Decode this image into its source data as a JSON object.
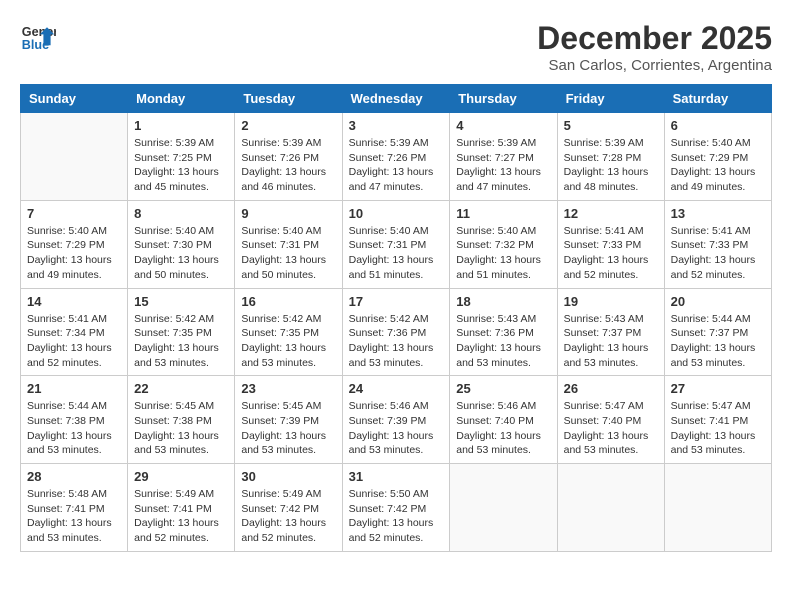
{
  "header": {
    "logo_line1": "General",
    "logo_line2": "Blue",
    "month_year": "December 2025",
    "location": "San Carlos, Corrientes, Argentina"
  },
  "days_of_week": [
    "Sunday",
    "Monday",
    "Tuesday",
    "Wednesday",
    "Thursday",
    "Friday",
    "Saturday"
  ],
  "weeks": [
    [
      {
        "day": "",
        "content": ""
      },
      {
        "day": "1",
        "content": "Sunrise: 5:39 AM\nSunset: 7:25 PM\nDaylight: 13 hours\nand 45 minutes."
      },
      {
        "day": "2",
        "content": "Sunrise: 5:39 AM\nSunset: 7:26 PM\nDaylight: 13 hours\nand 46 minutes."
      },
      {
        "day": "3",
        "content": "Sunrise: 5:39 AM\nSunset: 7:26 PM\nDaylight: 13 hours\nand 47 minutes."
      },
      {
        "day": "4",
        "content": "Sunrise: 5:39 AM\nSunset: 7:27 PM\nDaylight: 13 hours\nand 47 minutes."
      },
      {
        "day": "5",
        "content": "Sunrise: 5:39 AM\nSunset: 7:28 PM\nDaylight: 13 hours\nand 48 minutes."
      },
      {
        "day": "6",
        "content": "Sunrise: 5:40 AM\nSunset: 7:29 PM\nDaylight: 13 hours\nand 49 minutes."
      }
    ],
    [
      {
        "day": "7",
        "content": "Sunrise: 5:40 AM\nSunset: 7:29 PM\nDaylight: 13 hours\nand 49 minutes."
      },
      {
        "day": "8",
        "content": "Sunrise: 5:40 AM\nSunset: 7:30 PM\nDaylight: 13 hours\nand 50 minutes."
      },
      {
        "day": "9",
        "content": "Sunrise: 5:40 AM\nSunset: 7:31 PM\nDaylight: 13 hours\nand 50 minutes."
      },
      {
        "day": "10",
        "content": "Sunrise: 5:40 AM\nSunset: 7:31 PM\nDaylight: 13 hours\nand 51 minutes."
      },
      {
        "day": "11",
        "content": "Sunrise: 5:40 AM\nSunset: 7:32 PM\nDaylight: 13 hours\nand 51 minutes."
      },
      {
        "day": "12",
        "content": "Sunrise: 5:41 AM\nSunset: 7:33 PM\nDaylight: 13 hours\nand 52 minutes."
      },
      {
        "day": "13",
        "content": "Sunrise: 5:41 AM\nSunset: 7:33 PM\nDaylight: 13 hours\nand 52 minutes."
      }
    ],
    [
      {
        "day": "14",
        "content": "Sunrise: 5:41 AM\nSunset: 7:34 PM\nDaylight: 13 hours\nand 52 minutes."
      },
      {
        "day": "15",
        "content": "Sunrise: 5:42 AM\nSunset: 7:35 PM\nDaylight: 13 hours\nand 53 minutes."
      },
      {
        "day": "16",
        "content": "Sunrise: 5:42 AM\nSunset: 7:35 PM\nDaylight: 13 hours\nand 53 minutes."
      },
      {
        "day": "17",
        "content": "Sunrise: 5:42 AM\nSunset: 7:36 PM\nDaylight: 13 hours\nand 53 minutes."
      },
      {
        "day": "18",
        "content": "Sunrise: 5:43 AM\nSunset: 7:36 PM\nDaylight: 13 hours\nand 53 minutes."
      },
      {
        "day": "19",
        "content": "Sunrise: 5:43 AM\nSunset: 7:37 PM\nDaylight: 13 hours\nand 53 minutes."
      },
      {
        "day": "20",
        "content": "Sunrise: 5:44 AM\nSunset: 7:37 PM\nDaylight: 13 hours\nand 53 minutes."
      }
    ],
    [
      {
        "day": "21",
        "content": "Sunrise: 5:44 AM\nSunset: 7:38 PM\nDaylight: 13 hours\nand 53 minutes."
      },
      {
        "day": "22",
        "content": "Sunrise: 5:45 AM\nSunset: 7:38 PM\nDaylight: 13 hours\nand 53 minutes."
      },
      {
        "day": "23",
        "content": "Sunrise: 5:45 AM\nSunset: 7:39 PM\nDaylight: 13 hours\nand 53 minutes."
      },
      {
        "day": "24",
        "content": "Sunrise: 5:46 AM\nSunset: 7:39 PM\nDaylight: 13 hours\nand 53 minutes."
      },
      {
        "day": "25",
        "content": "Sunrise: 5:46 AM\nSunset: 7:40 PM\nDaylight: 13 hours\nand 53 minutes."
      },
      {
        "day": "26",
        "content": "Sunrise: 5:47 AM\nSunset: 7:40 PM\nDaylight: 13 hours\nand 53 minutes."
      },
      {
        "day": "27",
        "content": "Sunrise: 5:47 AM\nSunset: 7:41 PM\nDaylight: 13 hours\nand 53 minutes."
      }
    ],
    [
      {
        "day": "28",
        "content": "Sunrise: 5:48 AM\nSunset: 7:41 PM\nDaylight: 13 hours\nand 53 minutes."
      },
      {
        "day": "29",
        "content": "Sunrise: 5:49 AM\nSunset: 7:41 PM\nDaylight: 13 hours\nand 52 minutes."
      },
      {
        "day": "30",
        "content": "Sunrise: 5:49 AM\nSunset: 7:42 PM\nDaylight: 13 hours\nand 52 minutes."
      },
      {
        "day": "31",
        "content": "Sunrise: 5:50 AM\nSunset: 7:42 PM\nDaylight: 13 hours\nand 52 minutes."
      },
      {
        "day": "",
        "content": ""
      },
      {
        "day": "",
        "content": ""
      },
      {
        "day": "",
        "content": ""
      }
    ]
  ]
}
